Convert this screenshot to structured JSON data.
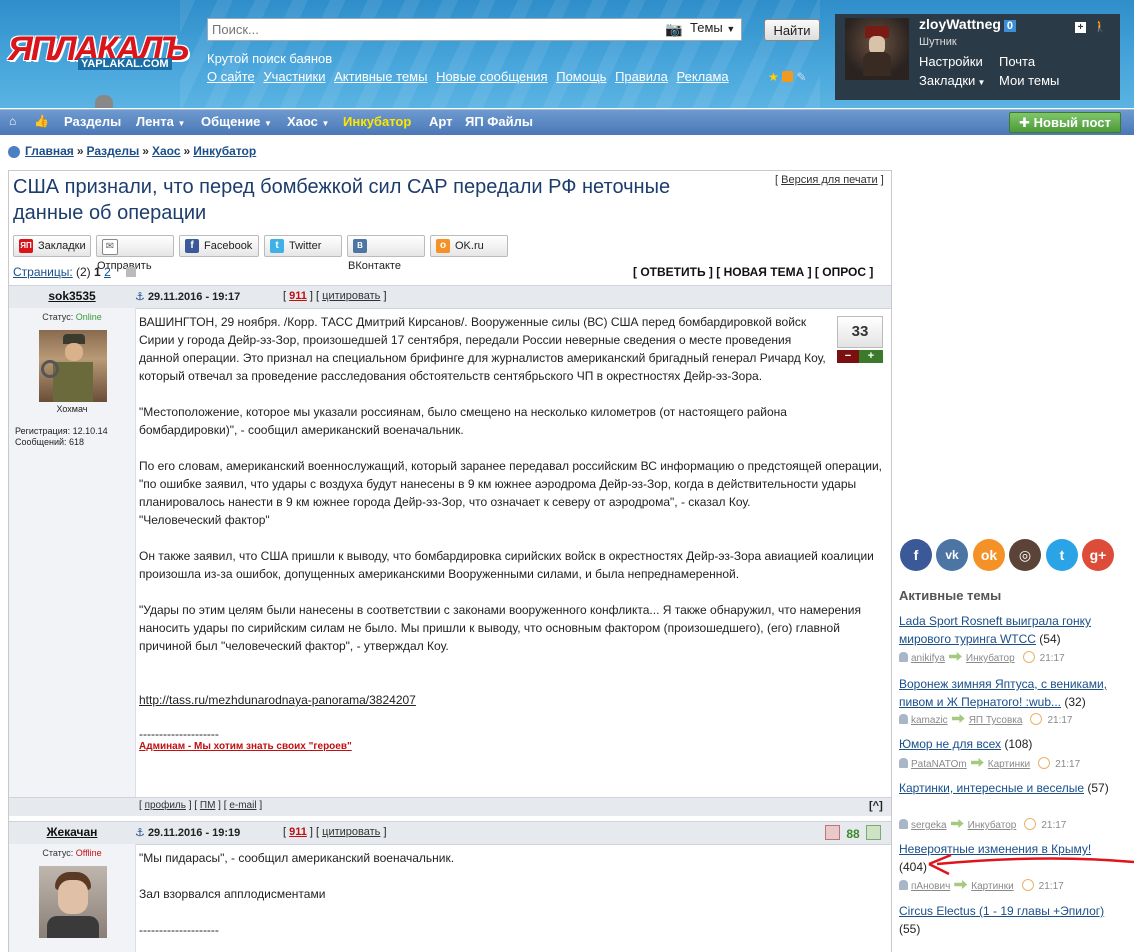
{
  "header": {
    "logo_main": "ЯПЛАКАЛЪ",
    "logo_sub": "YAPLAKAL.COM",
    "search_placeholder": "Поиск...",
    "topics_dropdown": "Темы",
    "find_button": "Найти",
    "slogan": "Крутой поиск баянов",
    "links": [
      "О сайте",
      "Участники",
      "Активные темы",
      "Новые сообщения",
      "Помощь",
      "Правила",
      "Реклама"
    ]
  },
  "user": {
    "name": "zloyWattneg",
    "count": "0",
    "rank": "Шутник",
    "settings": "Настройки",
    "mail": "Почта",
    "bookmarks": "Закладки",
    "my_topics": "Мои темы"
  },
  "nav": {
    "items": [
      "Разделы",
      "Лента",
      "Общение",
      "Хаос",
      "Инкубатор",
      "Арт",
      "ЯП Файлы"
    ],
    "new_post": "Новый пост"
  },
  "breadcrumb": [
    "Главная",
    "Разделы",
    "Хаос",
    "Инкубатор"
  ],
  "topic": {
    "title": "США признали, что перед бомбежкой сил САР передали РФ неточные данные об операции",
    "print_version": "Версия для печати"
  },
  "share": [
    "Закладки",
    "Отправить",
    "Facebook",
    "Twitter",
    "ВКонтакте",
    "OK.ru"
  ],
  "pages": {
    "label": "Страницы:",
    "count": "(2)",
    "current": "1",
    "next": "2"
  },
  "actions": "[ ОТВЕТИТЬ ] [ НОВАЯ ТЕМА ] [ ОПРОС ]",
  "posts": [
    {
      "author": "sok3535",
      "date": "29.11.2016 - 19:17",
      "post_id": "911",
      "quote": "цитировать",
      "status_label": "Статус:",
      "status": "Online",
      "rank": "Хохмач",
      "reg": "Регистрация: 12.10.14",
      "msgs": "Сообщений: 618",
      "rating": "33",
      "paragraphs": [
        "ВАШИНГТОН, 29 ноября. /Корр. ТАСС Дмитрий Кирсанов/. Вооруженные силы (ВС) США перед бомбардировкой войск Сирии у города Дейр-эз-Зор, произошедшей 17 сентября, передали России неверные сведения о месте проведения данной операции. Это признал на специальном брифинге для журналистов американский бригадный генерал Ричард Коу, который отвечал за проведение расследования обстоятельств сентябрьского ЧП в окрестностях Дейр-эз-Зора.",
        "\"Местоположение, которое мы указали россиянам, было смещено на несколько километров (от настоящего района бомбардировки)\", - сообщил американский военачальник.",
        "По его словам, американский военнослужащий, который заранее передавал российским ВС информацию о предстоящей операции, \"по ошибке заявил, что удары с воздуха будут нанесены в 9 км южнее аэродрома Дейр-эз-Зор, когда в действительности удары планировалось нанести в 9 км южнее города Дейр-эз-Зор, что означает к северу от аэродрома\", - сказал Коу.\n\"Человеческий фактор\"",
        "Он также заявил, что США пришли к выводу, что бомбардировка сирийских войск в окрестностях Дейр-эз-Зора авиацией коалиции произошла из-за ошибок, допущенных американскими Вооруженными силами, и была непреднамеренной.",
        "\"Удары по этим целям были нанесены в соответствии с законами вооруженного конфликта... Я также обнаружил, что намерения наносить удары по сирийским силам не было. Мы пришли к выводу, что основным фактором (произошедшего), (его) главной причиной был \"человеческий фактор\", - утверждал Коу."
      ],
      "link": "http://tass.ru/mezhdunarodnaya-panorama/3824207",
      "sig_line": "--------------------",
      "signature": "Админам - Мы хотим знать своих \"героев\"",
      "footer": [
        "профиль",
        "ПМ",
        "e-mail"
      ],
      "up": "[^]"
    },
    {
      "author": "Жекачан",
      "date": "29.11.2016 - 19:19",
      "post_id": "911",
      "quote": "цитировать",
      "status_label": "Статус:",
      "status": "Offline",
      "rating": "88",
      "paragraphs": [
        "\"Мы пидарасы\", - сообщил американский военачальник.",
        "Зал взорвался апплодисментами"
      ],
      "sig_line": "--------------------"
    }
  ],
  "active": {
    "title": "Активные темы",
    "items": [
      {
        "title": "Lada Sport Rosneft выиграла гонку мирового туринга WTCC",
        "count": "(54)",
        "user": "anikifya",
        "section": "Инкубатор",
        "time": "21:17"
      },
      {
        "title": "Воронеж зимняя Яптуса, с вениками, пивом и Ж Пернатого! :wub...",
        "count": "(32)",
        "user": "kamazic",
        "section": "ЯП Тусовка",
        "time": "21:17"
      },
      {
        "title": "Юмор не для всех",
        "count": "(108)",
        "user": "PataNATOm",
        "section": "Картинки",
        "time": "21:17"
      },
      {
        "title": "Картинки, интересные и веселые",
        "count": "(57)",
        "user": "sergeka",
        "section": "Инкубатор",
        "time": "21:17"
      },
      {
        "title": "Невероятные изменения в Крыму!",
        "count": "(404)",
        "user": "пАнович",
        "section": "Картинки",
        "time": "21:17"
      },
      {
        "title": "Circus Electus (1 - 19 главы +Эпилог)",
        "count": "(55)"
      }
    ]
  },
  "colors": {
    "accent": "#1a4f8a",
    "red": "#c01010",
    "annotation": "#e0141b"
  }
}
